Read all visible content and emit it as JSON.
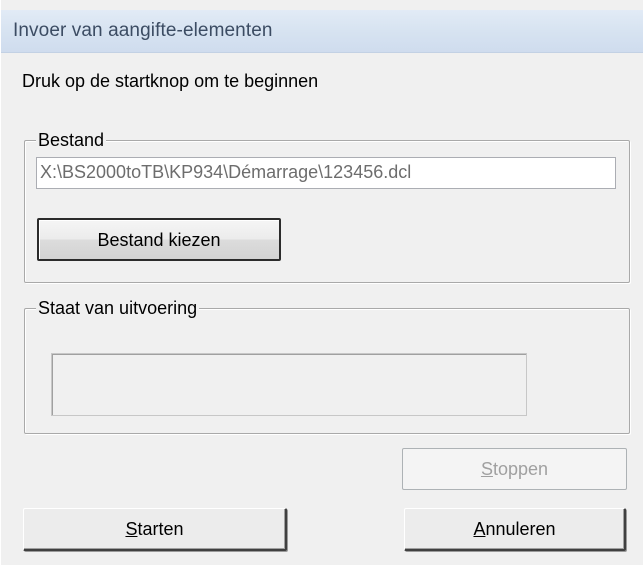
{
  "window": {
    "title": "Invoer van aangifte-elementen"
  },
  "instruction": "Druk op de startknop om te beginnen",
  "file_group": {
    "legend": "Bestand",
    "path_value": "X:\\BS2000toTB\\KP934\\Démarrage\\123456.dcl",
    "choose_button": "Bestand kiezen"
  },
  "status_group": {
    "legend": "Staat van uitvoering",
    "progress": 0
  },
  "buttons": {
    "stop": {
      "mnemonic": "S",
      "pre": "",
      "post": "toppen",
      "full": "Stoppen",
      "enabled": false
    },
    "start": {
      "mnemonic": "S",
      "pre": "",
      "post": "tarten",
      "full": "Starten",
      "enabled": true
    },
    "cancel": {
      "mnemonic": "A",
      "pre": "",
      "post": "nnuleren",
      "full": "Annuleren",
      "enabled": true
    }
  }
}
